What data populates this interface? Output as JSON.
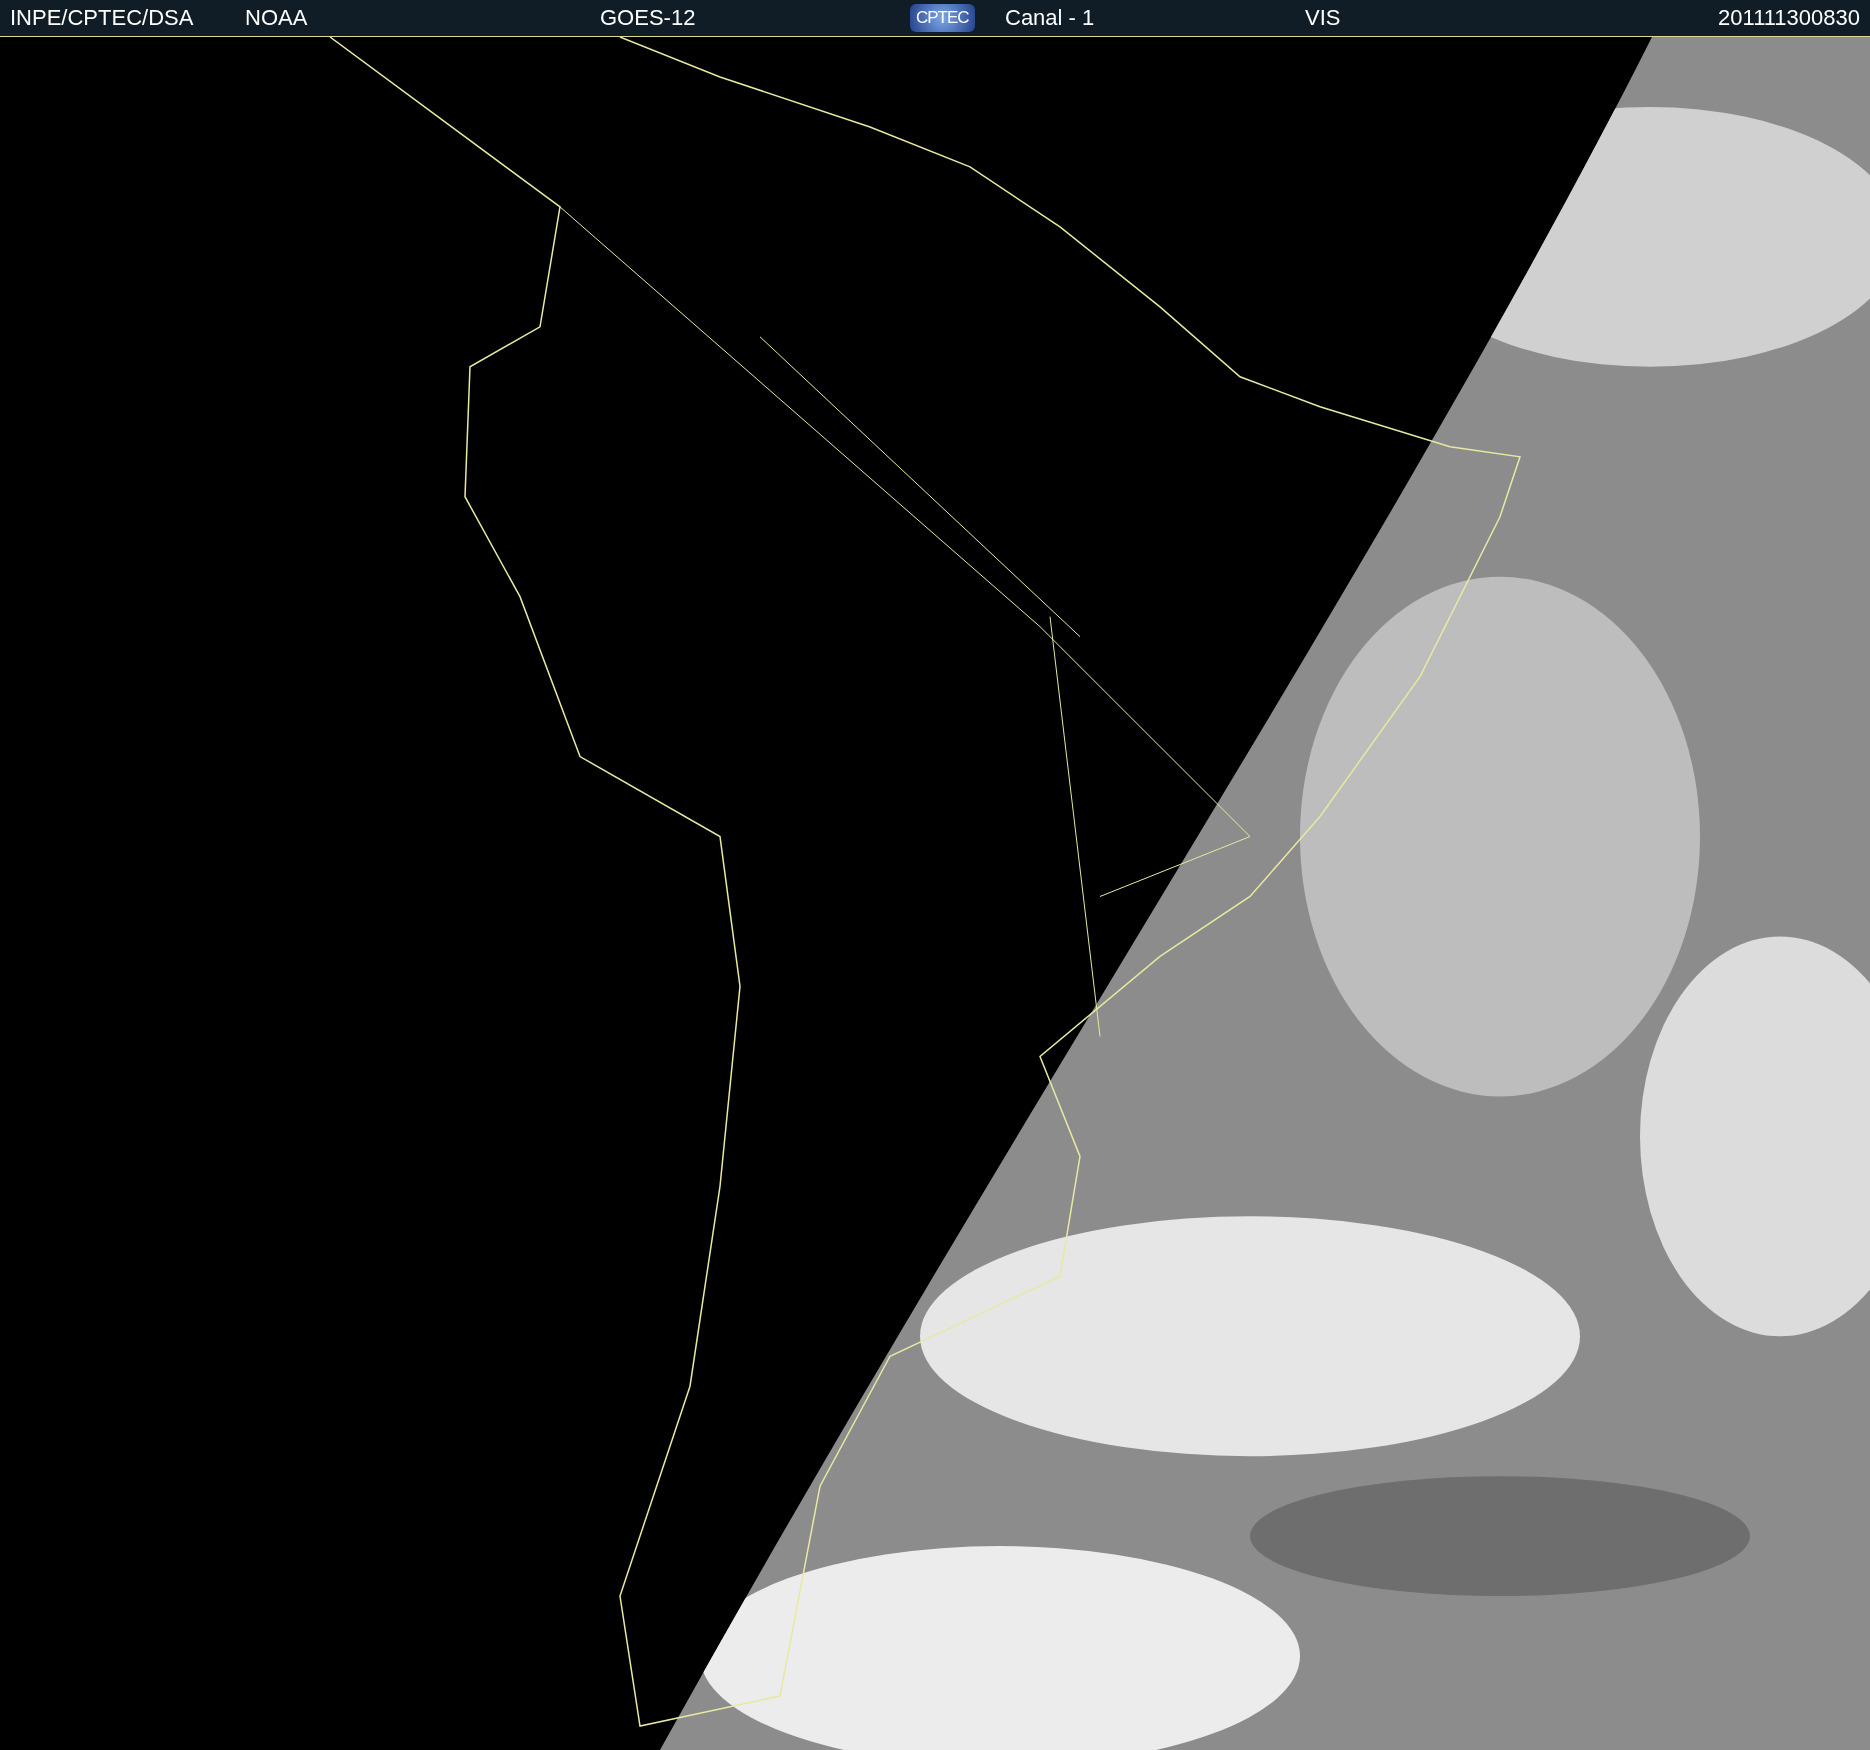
{
  "header": {
    "items": [
      {
        "kind": "text",
        "text": "INPE/CPTEC/DSA"
      },
      {
        "kind": "text",
        "text": "NOAA"
      },
      {
        "kind": "text",
        "text": "GOES-12"
      },
      {
        "kind": "logo",
        "text": "CPTEC"
      },
      {
        "kind": "text",
        "text": "Canal - 1"
      },
      {
        "kind": "text",
        "text": "VIS"
      },
      {
        "kind": "text",
        "text": "201111300830"
      }
    ]
  }
}
